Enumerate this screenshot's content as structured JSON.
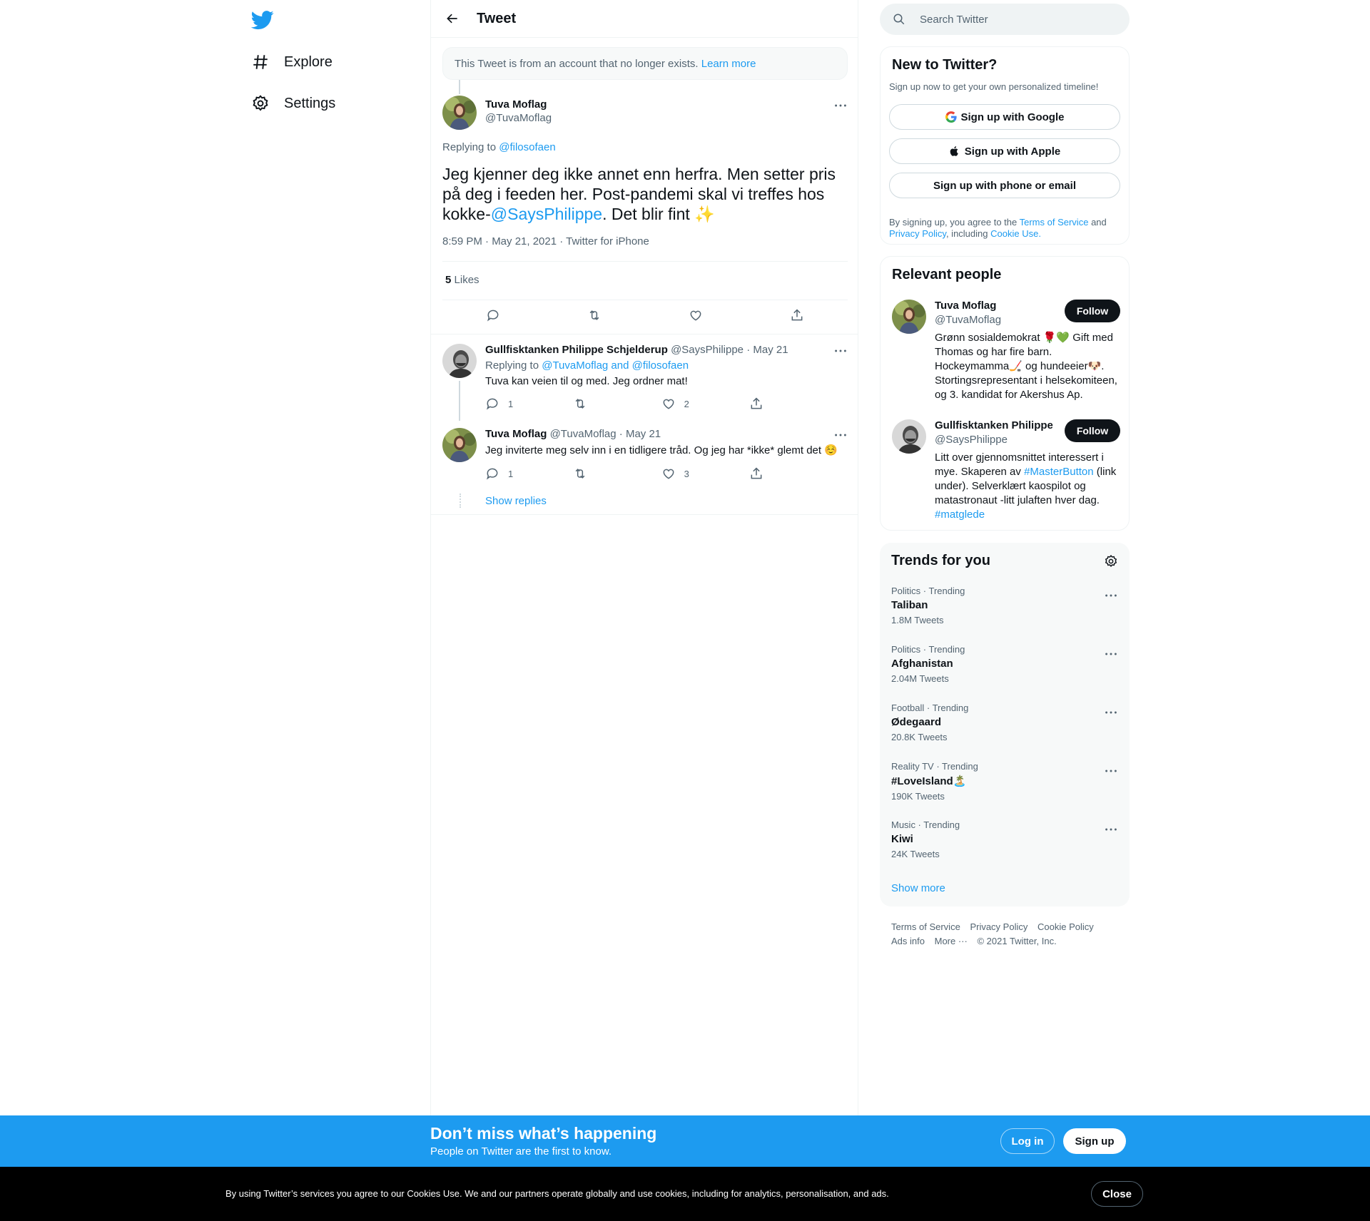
{
  "nav": {
    "logo": "twitter-bird-icon",
    "items": [
      {
        "label": "Explore",
        "icon": "hashtag-icon"
      },
      {
        "label": "Settings",
        "icon": "gear-icon"
      }
    ]
  },
  "header": {
    "title": "Tweet"
  },
  "notice": {
    "text": "This Tweet is from an account that no longer exists.",
    "link": "Learn more"
  },
  "main_tweet": {
    "name": "Tuva Moflag",
    "handle": "@TuvaMoflag",
    "replying_prefix": "Replying to",
    "replying_to": "@filosofaen",
    "text_part1": "Jeg kjenner deg ikke annet enn herfra. Men setter pris på deg i feeden her. Post-pandemi skal vi treffes hos kokke-",
    "mention": "@SaysPhilippe",
    "text_part2": ". Det blir fint ✨",
    "meta": "8:59 PM · May 21, 2021 · Twitter for iPhone",
    "likes_count": "5",
    "likes_label": "Likes"
  },
  "replies": [
    {
      "name": "Gullfisktanken Philippe Schjelderup",
      "handle": "@SaysPhilippe",
      "date": "· May 21",
      "replying_prefix": "Replying to",
      "replying_to": "@TuvaMoflag and @filosofaen",
      "text": "Tuva kan veien til og med. Jeg ordner mat!",
      "reply_count": "1",
      "retweet_count": "",
      "like_count": "2"
    },
    {
      "name": "Tuva Moflag",
      "handle": "@TuvaMoflag",
      "date": "· May 21",
      "text": "Jeg inviterte meg selv inn i en tidligere tråd. Og jeg har *ikke* glemt det ☺️",
      "reply_count": "1",
      "retweet_count": "",
      "like_count": "3"
    }
  ],
  "show_replies": "Show replies",
  "search": {
    "placeholder": "Search Twitter"
  },
  "new_to_twitter": {
    "title": "New to Twitter?",
    "subtitle": "Sign up now to get your own personalized timeline!",
    "google": "Sign up with Google",
    "apple": "Sign up with Apple",
    "phone": "Sign up with phone or email",
    "legal_1": "By signing up, you agree to the",
    "tos": "Terms of Service",
    "legal_2": "and",
    "privacy": "Privacy Policy",
    "legal_3": ", including",
    "cookie": "Cookie Use."
  },
  "relevant_people": {
    "title": "Relevant people",
    "people": [
      {
        "name": "Tuva Moflag",
        "handle": "@TuvaMoflag",
        "follow": "Follow",
        "bio": "Grønn sosialdemokrat 🌹💚 Gift med Thomas og har fire barn. Hockeymamma🏒 og hundeeier🐶. Stortingsrepresentant i helsekomiteen, og 3. kandidat for Akershus Ap."
      },
      {
        "name": "Gullfisktanken Philippe",
        "handle": "@SaysPhilippe",
        "follow": "Follow",
        "bio_part1": "Litt over gjennomsnittet interessert i mye. Skaperen av ",
        "bio_tag1": "#MasterButton",
        "bio_part2": " (link under). Selverklært kaospilot og matastronaut -litt julaften hver dag. ",
        "bio_tag2": "#matglede"
      }
    ]
  },
  "trends": {
    "title": "Trends for you",
    "items": [
      {
        "category": "Politics · Trending",
        "name": "Taliban",
        "count": "1.8M Tweets"
      },
      {
        "category": "Politics · Trending",
        "name": "Afghanistan",
        "count": "2.04M Tweets"
      },
      {
        "category": "Football · Trending",
        "name": "Ødegaard",
        "count": "20.8K Tweets"
      },
      {
        "category": "Reality TV · Trending",
        "name": "#LoveIsland🏝️",
        "count": "190K Tweets"
      },
      {
        "category": "Music · Trending",
        "name": "Kiwi",
        "count": "24K Tweets"
      }
    ],
    "show_more": "Show more"
  },
  "footer": {
    "links": [
      "Terms of Service",
      "Privacy Policy",
      "Cookie Policy",
      "Ads info",
      "More ···"
    ],
    "copyright": "© 2021 Twitter, Inc."
  },
  "signup_bar": {
    "title": "Don’t miss what’s happening",
    "subtitle": "People on Twitter are the first to know.",
    "login": "Log in",
    "signup": "Sign up"
  },
  "cookie_bar": {
    "text": "By using Twitter’s services you agree to our Cookies Use. We and our partners operate globally and use cookies, including for analytics, personalisation, and ads.",
    "close": "Close"
  },
  "colors": {
    "accent": "#1d9bf0",
    "text": "#0f1419",
    "muted": "#536471",
    "border": "#eff3f4"
  }
}
